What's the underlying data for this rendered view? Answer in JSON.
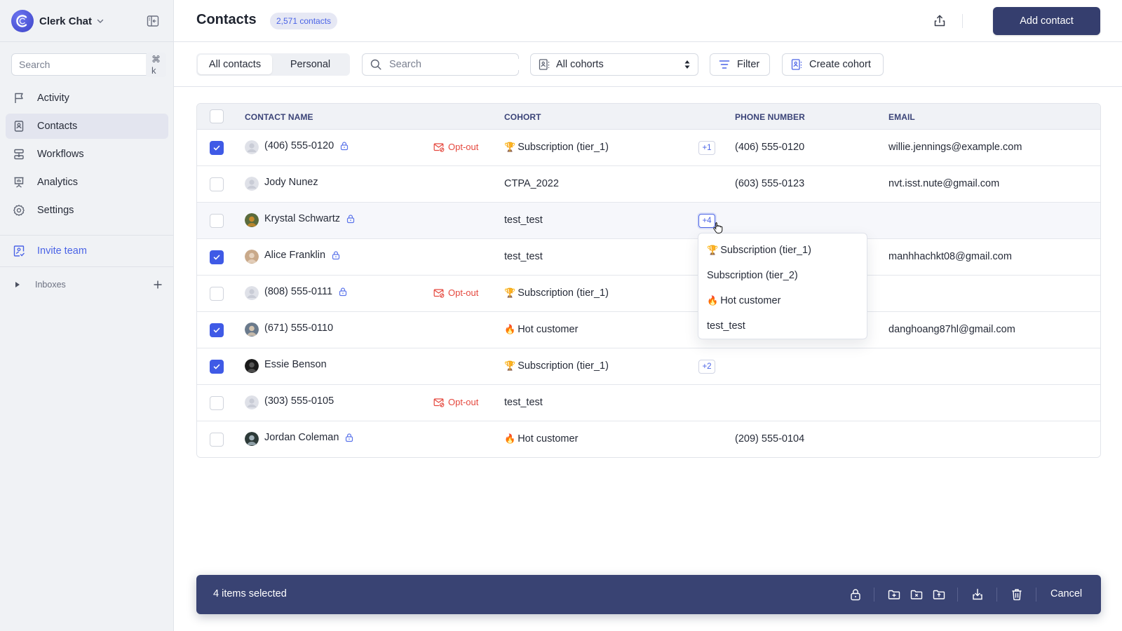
{
  "app": {
    "name": "Clerk Chat",
    "brand_color": "#4a4fd8"
  },
  "sidebar": {
    "search": {
      "placeholder": "Search",
      "shortcut": "⌘ k"
    },
    "items": [
      {
        "label": "Activity",
        "icon": "flag-icon",
        "active": false
      },
      {
        "label": "Contacts",
        "icon": "contact-book-icon",
        "active": true
      },
      {
        "label": "Workflows",
        "icon": "workflow-icon",
        "active": false
      },
      {
        "label": "Analytics",
        "icon": "presentation-chart-icon",
        "active": false
      },
      {
        "label": "Settings",
        "icon": "gear-icon",
        "active": false
      }
    ],
    "invite_label": "Invite team",
    "inboxes_label": "Inboxes"
  },
  "header": {
    "title": "Contacts",
    "count_badge": "2,571 contacts",
    "add_contact_label": "Add contact"
  },
  "toolbar": {
    "tabs": [
      {
        "label": "All contacts",
        "active": true
      },
      {
        "label": "Personal",
        "active": false
      }
    ],
    "search_placeholder": "Search",
    "cohort_select": "All cohorts",
    "filter_label": "Filter",
    "create_cohort_label": "Create cohort"
  },
  "table": {
    "columns": [
      "CONTACT NAME",
      "COHORT",
      "PHONE NUMBER",
      "EMAIL"
    ],
    "rows": [
      {
        "name": "(406) 555-0120",
        "checked": true,
        "locked": true,
        "opt_out": true,
        "avatar": "placeholder",
        "cohort_emoji": "🏆",
        "cohort": "Subscription (tier_1)",
        "extra": "+1",
        "phone": "(406) 555-0120",
        "email": "willie.jennings@example.com"
      },
      {
        "name": "Jody Nunez",
        "checked": false,
        "locked": false,
        "opt_out": false,
        "avatar": "placeholder",
        "cohort_emoji": "",
        "cohort": "CTPA_2022",
        "extra": "",
        "phone": "(603) 555-0123",
        "email": "nvt.isst.nute@gmail.com"
      },
      {
        "name": "Krystal Schwartz",
        "checked": false,
        "locked": true,
        "opt_out": false,
        "avatar": "photo",
        "cohort_emoji": "",
        "cohort": "test_test",
        "extra": "+4",
        "phone": "",
        "email": ""
      },
      {
        "name": "Alice Franklin",
        "checked": true,
        "locked": true,
        "opt_out": false,
        "avatar": "photo",
        "cohort_emoji": "",
        "cohort": "test_test",
        "extra": "",
        "phone": "",
        "email": "manhhachkt08@gmail.com"
      },
      {
        "name": "(808) 555-0111",
        "checked": false,
        "locked": true,
        "opt_out": true,
        "avatar": "placeholder",
        "cohort_emoji": "🏆",
        "cohort": "Subscription (tier_1)",
        "extra": "",
        "phone": "",
        "email": ""
      },
      {
        "name": "(671) 555-0110",
        "checked": true,
        "locked": false,
        "opt_out": false,
        "avatar": "photo",
        "cohort_emoji": "🔥",
        "cohort": "Hot customer",
        "extra": "",
        "phone": "",
        "email": "danghoang87hl@gmail.com"
      },
      {
        "name": "Essie Benson",
        "checked": true,
        "locked": false,
        "opt_out": false,
        "avatar": "photo",
        "cohort_emoji": "🏆",
        "cohort": "Subscription (tier_1)",
        "extra": "+2",
        "phone": "",
        "email": ""
      },
      {
        "name": "(303) 555-0105",
        "checked": false,
        "locked": false,
        "opt_out": true,
        "avatar": "placeholder",
        "cohort_emoji": "",
        "cohort": "test_test",
        "extra": "",
        "phone": "",
        "email": ""
      },
      {
        "name": "Jordan Coleman",
        "checked": false,
        "locked": true,
        "opt_out": false,
        "avatar": "photo",
        "cohort_emoji": "🔥",
        "cohort": "Hot customer",
        "extra": "",
        "phone": "(209) 555-0104",
        "email": ""
      }
    ],
    "opt_out_label": "Opt-out"
  },
  "cohort_popover": {
    "items": [
      {
        "emoji": "🏆",
        "label": "Subscription (tier_1)"
      },
      {
        "emoji": "",
        "label": "Subscription (tier_2)"
      },
      {
        "emoji": "🔥",
        "label": "Hot customer"
      },
      {
        "emoji": "",
        "label": "test_test"
      }
    ]
  },
  "bulk_bar": {
    "count_label": "4 items selected",
    "actions": [
      "lock-icon",
      "folder-add-icon",
      "folder-remove-icon",
      "folder-upload-icon",
      "download-icon",
      "trash-icon"
    ],
    "cancel_label": "Cancel"
  },
  "colors": {
    "primary": "#353e6e",
    "accent": "#4a63e6",
    "checkbox": "#3f5ae6",
    "opt_out": "#e5483e"
  }
}
